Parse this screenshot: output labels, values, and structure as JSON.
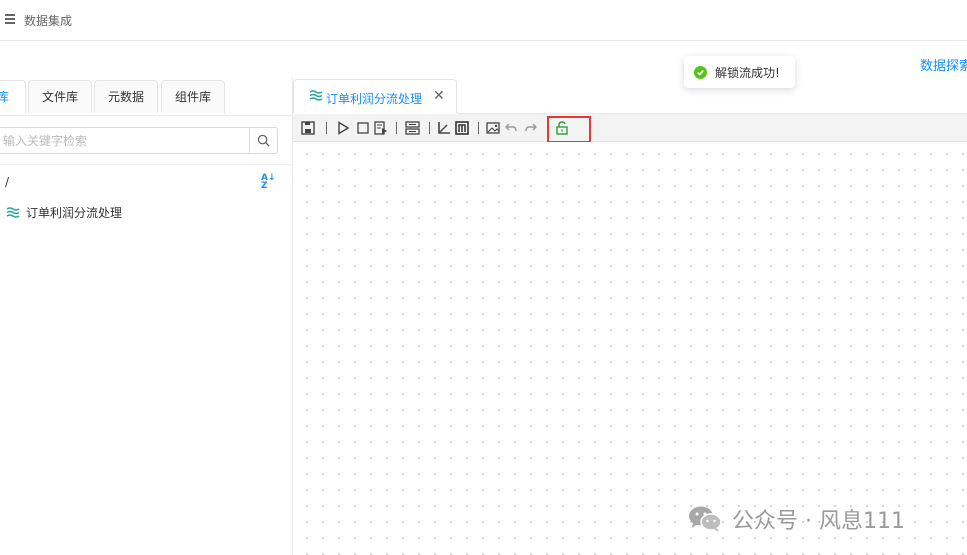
{
  "header": {
    "app_title": "数据集成",
    "explore_link": "数据探索"
  },
  "left_panel": {
    "tabs": [
      {
        "label": "库",
        "active": true
      },
      {
        "label": "文件库",
        "active": false
      },
      {
        "label": "元数据",
        "active": false
      },
      {
        "label": "组件库",
        "active": false
      }
    ],
    "search_placeholder": "输入关键字检索",
    "path_root": "/",
    "tree_items": [
      {
        "label": "订单利润分流处理",
        "icon": "flow-wave-icon"
      }
    ]
  },
  "editor": {
    "tab_label": "订单利润分流处理",
    "tab_close": "✕",
    "toolbar": [
      "save-icon",
      "run-icon",
      "stop-icon",
      "debug-icon",
      "layout-icon",
      "axis-icon",
      "template-icon",
      "image-icon",
      "undo-icon",
      "redo-icon",
      "unlock-icon"
    ]
  },
  "toast": {
    "message": "解锁流成功!",
    "type": "success"
  },
  "watermark": {
    "text": "公众号 · 风息111"
  },
  "colors": {
    "accent": "#1890ff",
    "success": "#52c41a",
    "highlight": "#e53935"
  }
}
